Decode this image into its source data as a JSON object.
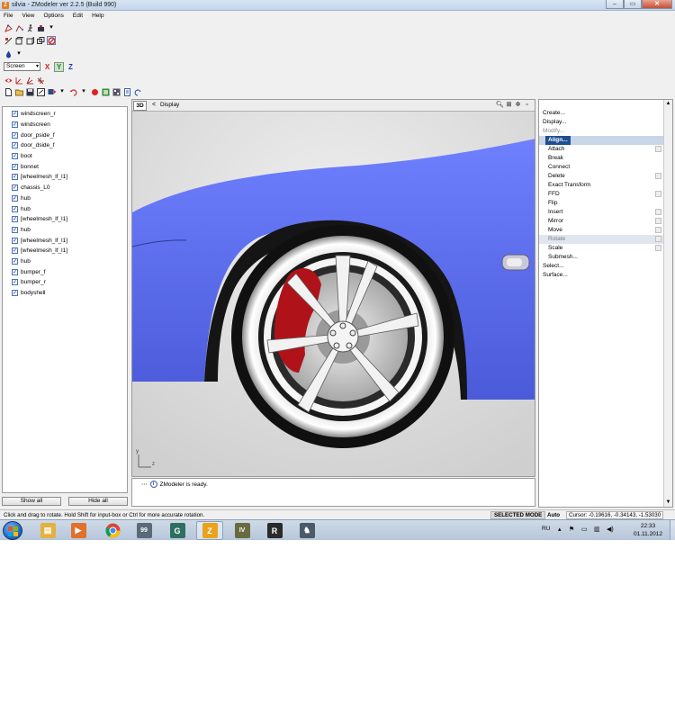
{
  "window": {
    "title": "silvia - ZModeler ver 2.2.5 (Build 990)",
    "app_icon": "Z",
    "minimize": "–",
    "maximize": "▭",
    "close": "✕"
  },
  "menu": [
    {
      "label": "File"
    },
    {
      "label": "View"
    },
    {
      "label": "Options"
    },
    {
      "label": "Edit"
    },
    {
      "label": "Help"
    }
  ],
  "toolbar": {
    "screen_select": "Screen",
    "axis_x": "X",
    "axis_y": "Y",
    "axis_z": "Z"
  },
  "objects": [
    {
      "label": "windscreen_r"
    },
    {
      "label": "windscreen"
    },
    {
      "label": "door_pside_f"
    },
    {
      "label": "door_dside_f"
    },
    {
      "label": "boot"
    },
    {
      "label": "bonnet"
    },
    {
      "label": "[wheelmesh_lf_l1]"
    },
    {
      "label": "chassis_L0"
    },
    {
      "label": "hub"
    },
    {
      "label": "hub"
    },
    {
      "label": "[wheelmesh_lf_l1]"
    },
    {
      "label": "hub"
    },
    {
      "label": "[wheelmesh_lf_l1]"
    },
    {
      "label": "[wheelmesh_lf_l1]"
    },
    {
      "label": "hub"
    },
    {
      "label": "bumper_f"
    },
    {
      "label": "bumper_r"
    },
    {
      "label": "bodyshell"
    }
  ],
  "left_buttons": {
    "show_all": "Show all",
    "hide_all": "Hide all"
  },
  "viewport": {
    "mode": "3D",
    "chevron": "<",
    "display_label": "Display",
    "axis_y": "y",
    "axis_z": "z"
  },
  "log": {
    "message": "ZModeler is ready."
  },
  "commands": {
    "create": "Create...",
    "display": "Display...",
    "modify": "Modify...",
    "align": "Align...",
    "attach": "Attach",
    "break": "Break",
    "connect": "Connect",
    "delete": "Delete",
    "exact_transform": "Exact Transform",
    "ffd": "FFD",
    "flip": "Flip",
    "insert": "Insert",
    "mirror": "Mirror",
    "move": "Move",
    "rotate": "Rotate",
    "scale": "Scale",
    "submesh": "Submesh...",
    "select": "Select...",
    "surface": "Surface..."
  },
  "status": {
    "message": "Click and drag to rotate. Hold Shift for input-box or Ctrl for more accurate rotation.",
    "mode": "SELECTED MODE",
    "auto": "Auto",
    "cursor": "Cursor: -0.19616, -0.34143, -1.53030"
  },
  "taskbar": {
    "lang": "RU",
    "time": "22:33",
    "date": "01.11.2012",
    "apps": [
      {
        "name": "explorer",
        "glyph": "▤",
        "color": "#e3b13f"
      },
      {
        "name": "media-player",
        "glyph": "▶",
        "color": "#e0702a"
      },
      {
        "name": "chrome",
        "glyph": "●",
        "color": "#3f8f3f"
      },
      {
        "name": "app-99",
        "glyph": "99",
        "color": "#5a6a7a"
      },
      {
        "name": "app-g",
        "glyph": "G",
        "color": "#2f6f5f"
      },
      {
        "name": "zmodeler",
        "glyph": "Z",
        "color": "#e8a21c"
      },
      {
        "name": "gta-iv",
        "glyph": "IV",
        "color": "#6a6a40"
      },
      {
        "name": "rockstar",
        "glyph": "R",
        "color": "#2a2a2a"
      },
      {
        "name": "app-figure",
        "glyph": "♞",
        "color": "#4a5a6a"
      }
    ]
  },
  "colors": {
    "car_body": "#5a6cf0",
    "brake_caliper": "#b0121a",
    "selection": "#1f4f8f"
  }
}
